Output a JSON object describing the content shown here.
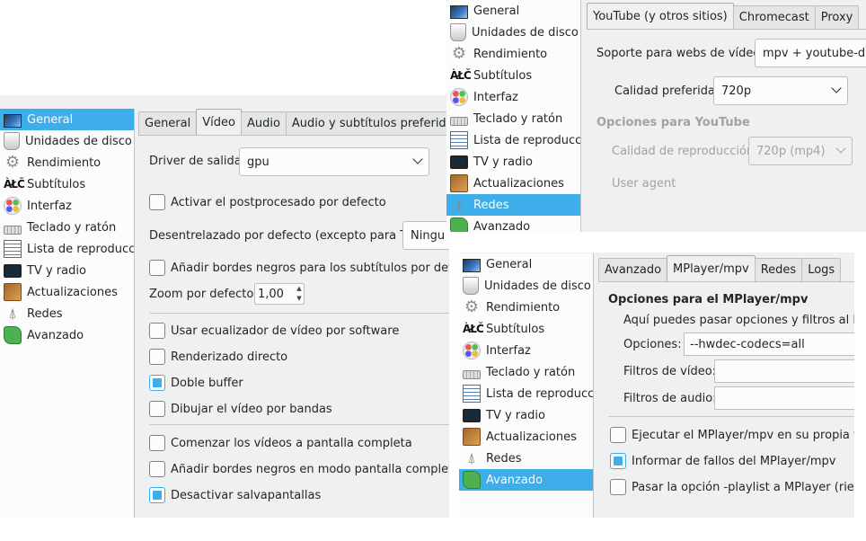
{
  "sidebar_items": [
    {
      "label": "General",
      "icon": "general-icon"
    },
    {
      "label": "Unidades de disco",
      "icon": "disk-drive-icon"
    },
    {
      "label": "Rendimiento",
      "icon": "gear-icon"
    },
    {
      "label": "Subtítulos",
      "icon": "subtitles-icon"
    },
    {
      "label": "Interfaz",
      "icon": "palette-icon"
    },
    {
      "label": "Teclado y ratón",
      "icon": "keyboard-icon"
    },
    {
      "label": "Lista de reproduccio",
      "icon": "playlist-icon"
    },
    {
      "label": "TV y radio",
      "icon": "tv-icon"
    },
    {
      "label": "Actualizaciones",
      "icon": "updates-icon"
    },
    {
      "label": "Redes",
      "icon": "network-icon"
    },
    {
      "label": "Avanzado",
      "icon": "puzzle-icon"
    }
  ],
  "panel_video": {
    "selected_item": "General",
    "tabs": [
      "General",
      "Vídeo",
      "Audio",
      "Audio y subtítulos preferidos"
    ],
    "active_tab": "Vídeo",
    "output_driver_label": "Driver de salida:",
    "output_driver_value": "gpu",
    "postprocess_label": "Activar el postprocesado por defecto",
    "deinterlace_label": "Desentrelazado por defecto (excepto para TV):",
    "deinterlace_value": "Ningu",
    "black_borders_subs_label": "Añadir bordes negros para los subtítulos por defecto",
    "zoom_label": "Zoom por defecto:",
    "zoom_value": "1,00",
    "sw_equalizer_label": "Usar ecualizador de vídeo por software",
    "direct_render_label": "Renderizado directo",
    "double_buffer_label": "Doble buffer",
    "draw_slices_label": "Dibujar el vídeo por bandas",
    "start_fullscreen_label": "Comenzar los vídeos a pantalla completa",
    "black_borders_fs_label": "Añadir bordes negros en modo pantalla completa",
    "disable_screensaver_label": "Desactivar salvapantallas",
    "checked": {
      "postprocess": false,
      "black_borders_subs": false,
      "sw_equalizer": false,
      "direct_render": false,
      "double_buffer": true,
      "draw_slices": false,
      "start_fullscreen": false,
      "black_borders_fs": false,
      "disable_screensaver": true
    }
  },
  "panel_network": {
    "selected_item": "Redes",
    "tabs": [
      "YouTube (y otros sitios)",
      "Chromecast",
      "Proxy"
    ],
    "active_tab": "YouTube (y otros sitios)",
    "support_label": "Soporte para webs de vídeo:",
    "support_value": "mpv + youtube-dl",
    "quality_label": "Calidad preferida:",
    "quality_value": "720p",
    "youtube_section": "Opciones para YouTube",
    "playback_quality_label": "Calidad de reproducción",
    "playback_quality_value": "720p (mp4)",
    "user_agent_label": "User agent"
  },
  "panel_advanced": {
    "selected_item": "Avanzado",
    "tabs": [
      "Avanzado",
      "MPlayer/mpv",
      "Redes",
      "Logs"
    ],
    "active_tab": "MPlayer/mpv",
    "section_title": "Opciones para el MPlayer/mpv",
    "description": "Aquí puedes pasar opciones y filtros al MPla",
    "options_label": "Opciones:",
    "options_value": "--hwdec-codecs=all",
    "video_filters_label": "Filtros de vídeo:",
    "video_filters_value": "",
    "audio_filters_label": "Filtros de audio:",
    "audio_filters_value": "",
    "run_own_window_label": "Ejecutar el MPlayer/mpv en su propia vent",
    "report_errors_label": "Informar de fallos del MPlayer/mpv",
    "playlist_option_label": "Pasar la opción -playlist a MPlayer (riesgo d",
    "checked": {
      "run_own_window": false,
      "report_errors": true,
      "playlist_option": false
    }
  },
  "colors": {
    "selection": "#3daee9",
    "window_bg": "#eff0f1",
    "sidebar_bg": "#fcfcfc",
    "text": "#232627"
  }
}
